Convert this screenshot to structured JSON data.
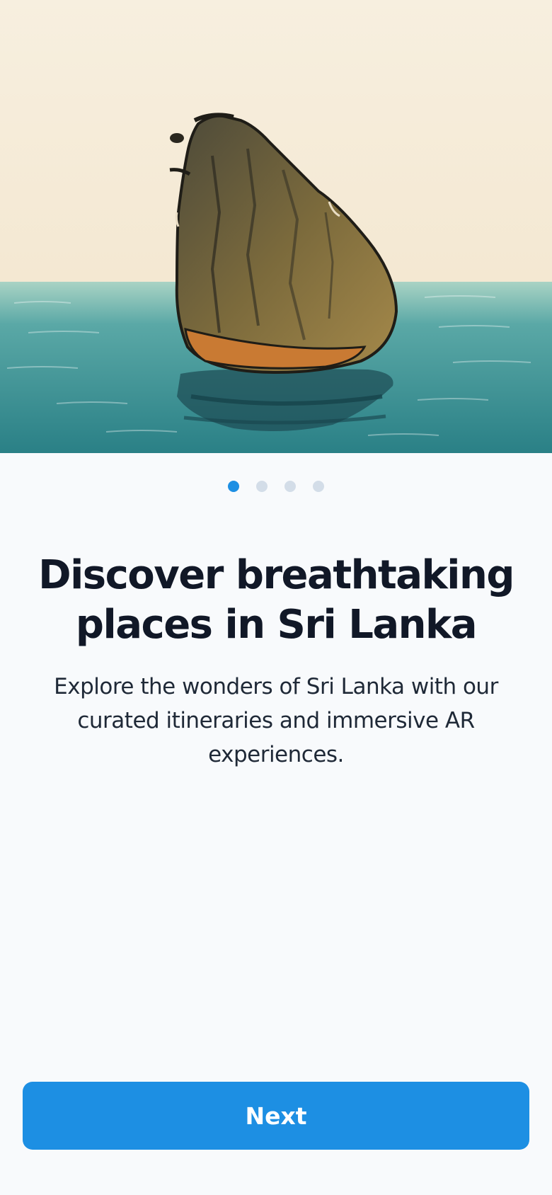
{
  "onboarding": {
    "title": "Discover breathtaking places in Sri Lanka",
    "description": "Explore the wonders of Sri Lanka with our curated itineraries and immersive AR experiences.",
    "next_label": "Next",
    "page_indicator": {
      "total_pages": 4,
      "active_page": 1
    }
  },
  "colors": {
    "accent": "#1d8fe3",
    "dot_inactive": "#d3dde8",
    "background": "#f8fafc",
    "sky": "#f6eedd",
    "sea": "#3a9596",
    "title_text": "#111827",
    "body_text": "#1f2937"
  }
}
